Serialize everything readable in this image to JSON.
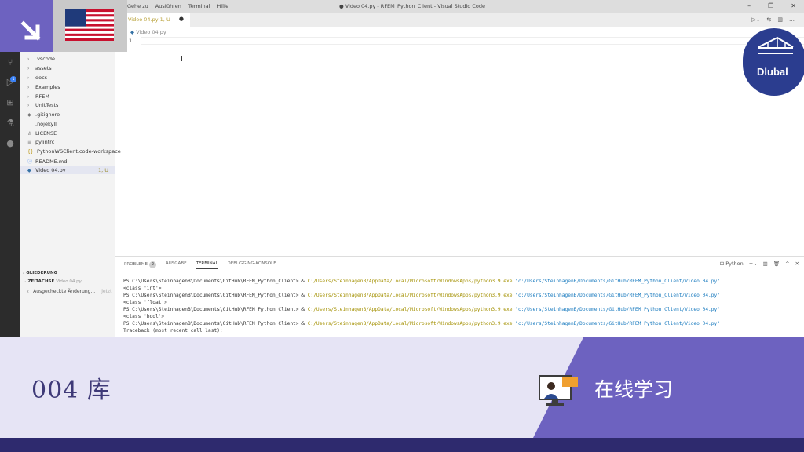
{
  "window": {
    "title": "● Video 04.py - RFEM_Python_Client - Visual Studio Code",
    "menu": [
      "Gehe zu",
      "Ausführen",
      "Terminal",
      "Hilfe"
    ]
  },
  "explorer": {
    "items": [
      {
        "icon": "›",
        "label": ".vscode"
      },
      {
        "icon": "›",
        "label": "assets"
      },
      {
        "icon": "›",
        "label": "docs"
      },
      {
        "icon": "›",
        "label": "Examples"
      },
      {
        "icon": "›",
        "label": "RFEM"
      },
      {
        "icon": "›",
        "label": "UnitTests"
      },
      {
        "icon": "◆",
        "label": ".gitignore"
      },
      {
        "icon": "",
        "label": ".nojekyll"
      },
      {
        "icon": "♙",
        "label": "LICENSE"
      },
      {
        "icon": "≡",
        "label": "pylintrc"
      },
      {
        "icon": "{}",
        "label": "PythonWSClient.code-workspace"
      },
      {
        "icon": "ⓘ",
        "label": "README.md"
      },
      {
        "icon": "◆",
        "label": "Video 04.py",
        "status": "1, U"
      }
    ],
    "outline_label": "GLIEDERUNG",
    "timeline_label": "ZEITACHSE",
    "timeline_file": "Video 04.py",
    "timeline_entry": "Ausgecheckte Änderung...",
    "timeline_time": "jetzt"
  },
  "editor": {
    "tab_label": "Video 04.py",
    "tab_status": "1, U",
    "breadcrumb": "Video 04.py",
    "line_number": "1"
  },
  "panel": {
    "tabs": [
      "PROBLEME",
      "AUSGABE",
      "TERMINAL",
      "DEBUGGING-KONSOLE"
    ],
    "problems_count": "2",
    "shell": "Python",
    "lines": [
      {
        "prompt": "PS C:\\Users\\SteinhagenB\\Documents\\GitHub\\RFEM_Python_Client> & ",
        "exe": "C:/Users/SteinhagenB/AppData/Local/Microsoft/WindowsApps/python3.9.exe",
        "arg": " \"c:/Users/SteinhagenB/Documents/GitHub/RFEM_Python_Client/Video 04.py\""
      },
      {
        "text": "<class 'int'>"
      },
      {
        "prompt": "PS C:\\Users\\SteinhagenB\\Documents\\GitHub\\RFEM_Python_Client> & ",
        "exe": "C:/Users/SteinhagenB/AppData/Local/Microsoft/WindowsApps/python3.9.exe",
        "arg": " \"c:/Users/SteinhagenB/Documents/GitHub/RFEM_Python_Client/Video 04.py\""
      },
      {
        "text": "<class 'float'>"
      },
      {
        "prompt": "PS C:\\Users\\SteinhagenB\\Documents\\GitHub\\RFEM_Python_Client> & ",
        "exe": "C:/Users/SteinhagenB/AppData/Local/Microsoft/WindowsApps/python3.9.exe",
        "arg": " \"c:/Users/SteinhagenB/Documents/GitHub/RFEM_Python_Client/Video 04.py\""
      },
      {
        "text": "<class 'bool'>"
      },
      {
        "prompt": "PS C:\\Users\\SteinhagenB\\Documents\\GitHub\\RFEM_Python_Client> & ",
        "exe": "C:/Users/SteinhagenB/AppData/Local/Microsoft/WindowsApps/python3.9.exe",
        "arg": " \"c:/Users/SteinhagenB/Documents/GitHub/RFEM_Python_Client/Video 04.py\""
      },
      {
        "text": "Traceback (most recent call last):"
      }
    ]
  },
  "banner": {
    "title": "004  库",
    "subtitle": "在线学习",
    "brand": "Dlubal",
    "accent": "#6d62c0",
    "dark": "#2e2a6e"
  }
}
